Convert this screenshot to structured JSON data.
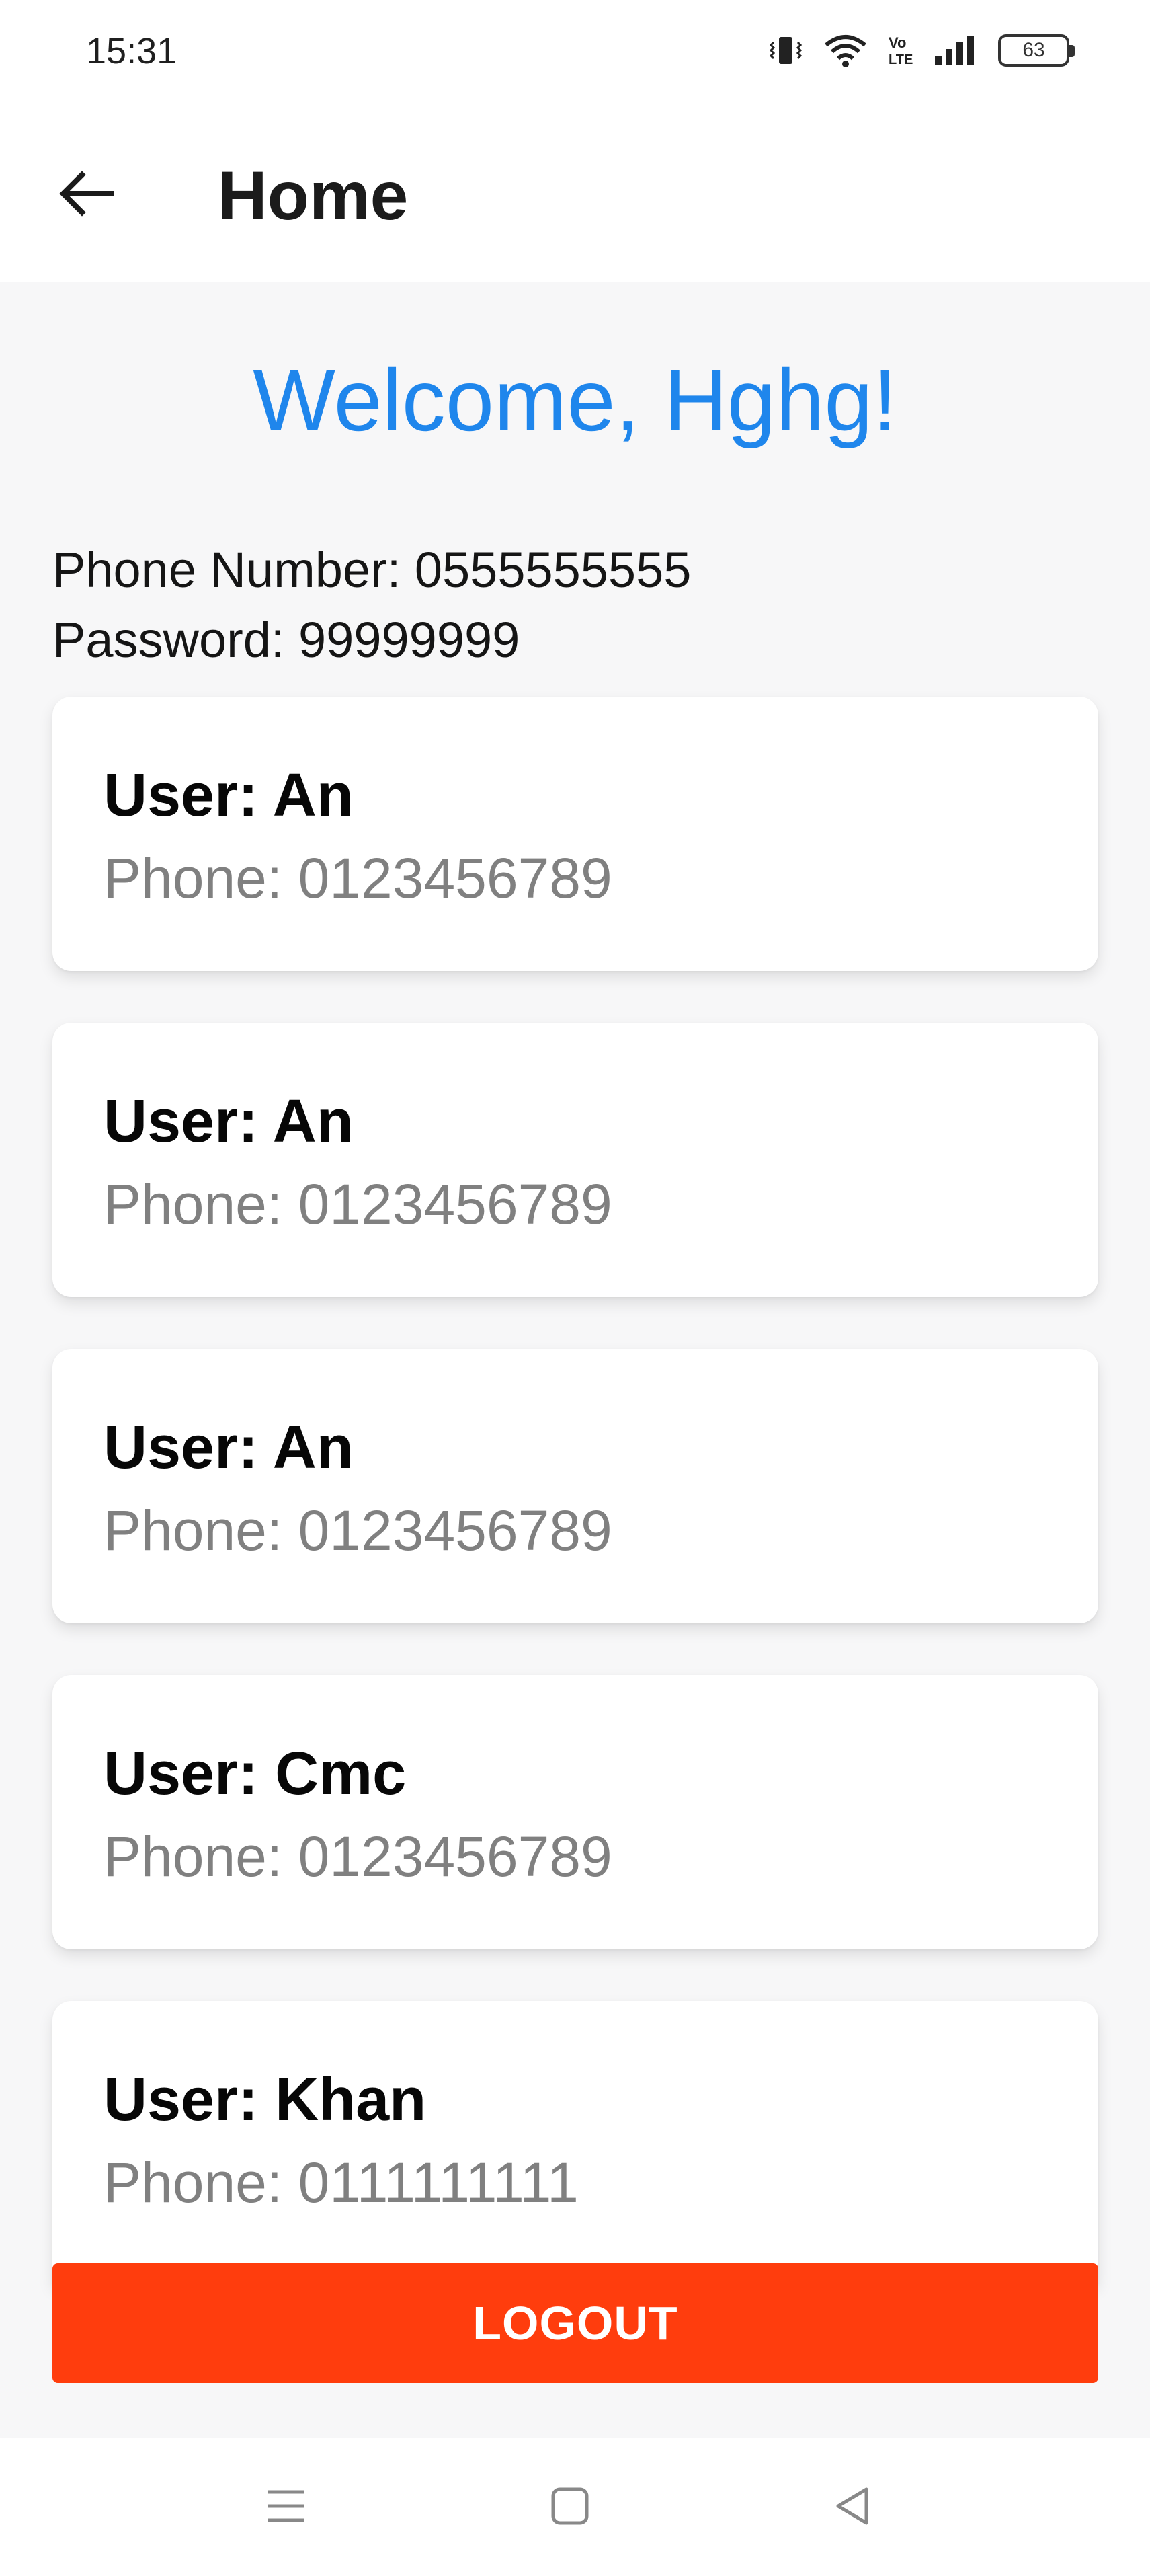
{
  "status_bar": {
    "time": "15:31",
    "battery_level": "63",
    "icons": [
      "vibrate-icon",
      "wifi-icon",
      "volte-icon",
      "signal-icon",
      "battery-icon"
    ]
  },
  "app_bar": {
    "title": "Home",
    "back_icon": "arrow-left-icon"
  },
  "main": {
    "welcome": "Welcome, Hghg!",
    "phone_line": "Phone Number: 0555555555",
    "password_line": "Password: 99999999",
    "users": [
      {
        "user": "User: An",
        "phone": "Phone: 0123456789"
      },
      {
        "user": "User: An",
        "phone": "Phone: 0123456789"
      },
      {
        "user": "User: An",
        "phone": "Phone: 0123456789"
      },
      {
        "user": "User: Cmc",
        "phone": "Phone: 0123456789"
      },
      {
        "user": "User: Khan",
        "phone": "Phone: 0111111111"
      }
    ],
    "logout_label": "LOGOUT"
  },
  "nav_bar": {
    "icons": [
      "menu-icon",
      "home-square-icon",
      "back-triangle-icon"
    ]
  },
  "colors": {
    "accent": "#1f86ec",
    "logout": "#ff3d0d",
    "background": "#f7f7f8"
  }
}
